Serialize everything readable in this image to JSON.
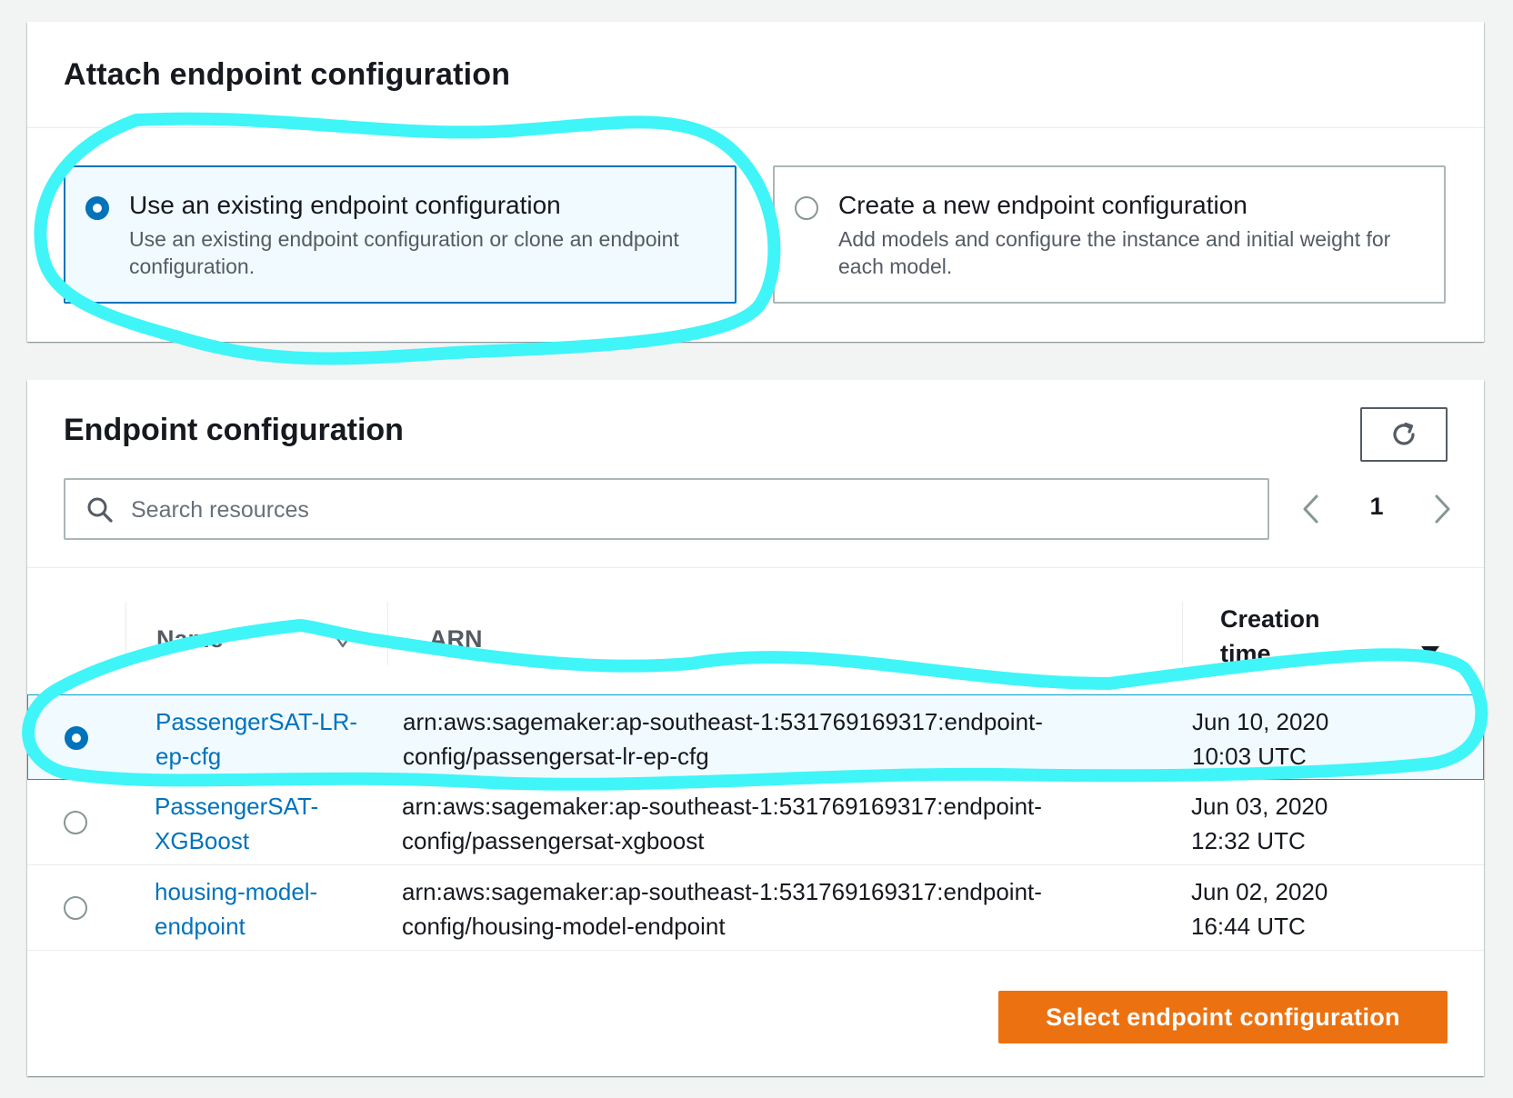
{
  "attach": {
    "title": "Attach endpoint configuration",
    "options": [
      {
        "title": "Use an existing endpoint configuration",
        "description": "Use an existing endpoint configuration or clone an endpoint configuration.",
        "selected": true
      },
      {
        "title": "Create a new endpoint configuration",
        "description": "Add models and configure the instance and initial weight for each model.",
        "selected": false
      }
    ]
  },
  "endpoint": {
    "title": "Endpoint configuration",
    "search_placeholder": "Search resources",
    "page": "1",
    "columns": {
      "name": "Name",
      "arn": "ARN",
      "creation_time": "Creation time"
    },
    "rows": [
      {
        "name": "PassengerSAT-LR-ep-cfg",
        "arn": "arn:aws:sagemaker:ap-southeast-1:531769169317:endpoint-config/passengersat-lr-ep-cfg",
        "time": "Jun 10, 2020 10:03 UTC",
        "selected": true
      },
      {
        "name": "PassengerSAT-XGBoost",
        "arn": "arn:aws:sagemaker:ap-southeast-1:531769169317:endpoint-config/passengersat-xgboost",
        "time": "Jun 03, 2020 12:32 UTC",
        "selected": false
      },
      {
        "name": "housing-model-endpoint",
        "arn": "arn:aws:sagemaker:ap-southeast-1:531769169317:endpoint-config/housing-model-endpoint",
        "time": "Jun 02, 2020 16:44 UTC",
        "selected": false
      }
    ],
    "select_button": "Select endpoint configuration"
  },
  "colors": {
    "accent": "#0073bb",
    "primary_button": "#ec7211",
    "annotation": "#3ff5f8"
  },
  "icons": [
    "refresh-icon",
    "search-icon",
    "chevron-left-icon",
    "chevron-right-icon",
    "sort-icon",
    "sort-down-icon"
  ]
}
